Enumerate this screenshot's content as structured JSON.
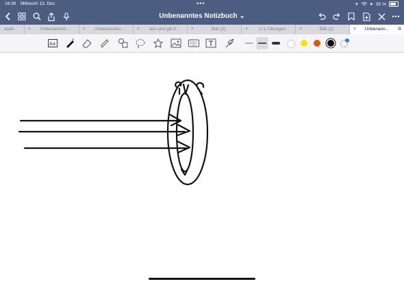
{
  "status": {
    "time": "16:38",
    "date": "Mittwoch 13. Dez.",
    "dots": "•••",
    "battery": "92 %"
  },
  "toolbar": {
    "title": "Unbenanntes Notizbuch",
    "title_chevron": "⌄"
  },
  "tabs": [
    {
      "label": "arafo",
      "close": "×"
    },
    {
      "label": "Unbenanntes ...",
      "close": "×"
    },
    {
      "label": "Unbenanntes ...",
      "close": "×"
    },
    {
      "label": "aus und gib il...",
      "close": "×"
    },
    {
      "label": "Bild (2)",
      "close": "×"
    },
    {
      "label": "Li L Übungen",
      "close": "×"
    },
    {
      "label": "Bild (1)",
      "close": "×"
    },
    {
      "label": "Unbenann...",
      "close": "×",
      "active": true
    }
  ],
  "pen_colors": [
    "#ffffff",
    "#f5e414",
    "#e0560f",
    "#111111",
    "#2f7bf6"
  ],
  "selected_color": "#111111",
  "stroke_color": "#111111"
}
